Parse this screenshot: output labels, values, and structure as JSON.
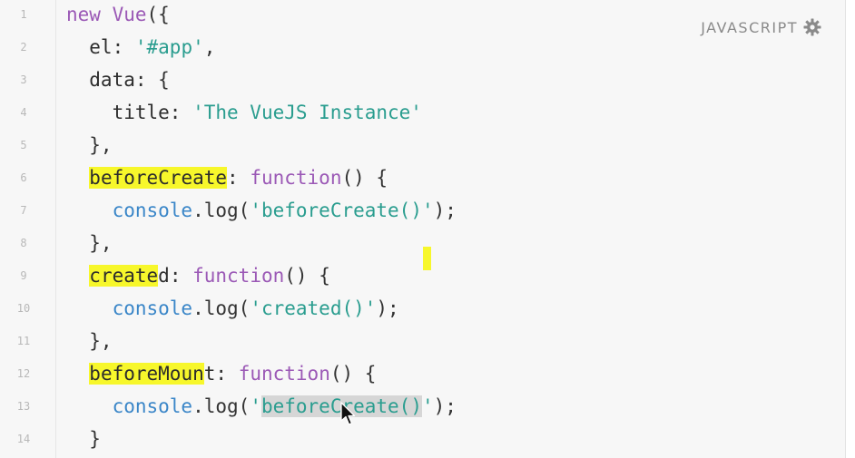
{
  "window": {
    "language_label": "JAVASCRIPT",
    "language_settings_icon": "gear-icon"
  },
  "editor": {
    "line_numbers": [
      "1",
      "2",
      "3",
      "4",
      "5",
      "6",
      "7",
      "8",
      "9",
      "10",
      "11",
      "12",
      "13",
      "14"
    ],
    "lines": [
      {
        "tokens": [
          {
            "text": "new ",
            "type": "kw"
          },
          {
            "text": "Vue",
            "type": "fn"
          },
          {
            "text": "({",
            "type": "pun"
          }
        ]
      },
      {
        "tokens": [
          {
            "text": "  el",
            "type": "id"
          },
          {
            "text": ": ",
            "type": "pun"
          },
          {
            "text": "'#app'",
            "type": "str"
          },
          {
            "text": ",",
            "type": "pun"
          }
        ]
      },
      {
        "tokens": [
          {
            "text": "  data",
            "type": "id"
          },
          {
            "text": ": {",
            "type": "pun"
          }
        ]
      },
      {
        "tokens": [
          {
            "text": "    title",
            "type": "id"
          },
          {
            "text": ": ",
            "type": "pun"
          },
          {
            "text": "'The VueJS Instance'",
            "type": "str"
          }
        ]
      },
      {
        "tokens": [
          {
            "text": "  },",
            "type": "pun"
          }
        ]
      },
      {
        "tokens": [
          {
            "text": "  ",
            "type": "pun"
          },
          {
            "text": "beforeCreate",
            "type": "id",
            "highlight": true
          },
          {
            "text": ": ",
            "type": "pun"
          },
          {
            "text": "function",
            "type": "kw"
          },
          {
            "text": "() {",
            "type": "pun"
          }
        ]
      },
      {
        "tokens": [
          {
            "text": "    ",
            "type": "pun"
          },
          {
            "text": "console",
            "type": "obj"
          },
          {
            "text": ".log(",
            "type": "pun"
          },
          {
            "text": "'beforeCreate()'",
            "type": "str"
          },
          {
            "text": ");",
            "type": "pun"
          }
        ]
      },
      {
        "tokens": [
          {
            "text": "  },",
            "type": "pun"
          }
        ]
      },
      {
        "tokens": [
          {
            "text": "  ",
            "type": "pun"
          },
          {
            "text": "create",
            "type": "id",
            "highlight": true
          },
          {
            "text": "d",
            "type": "id"
          },
          {
            "text": ": ",
            "type": "pun"
          },
          {
            "text": "function",
            "type": "kw"
          },
          {
            "text": "() {",
            "type": "pun"
          }
        ]
      },
      {
        "tokens": [
          {
            "text": "    ",
            "type": "pun"
          },
          {
            "text": "console",
            "type": "obj"
          },
          {
            "text": ".log(",
            "type": "pun"
          },
          {
            "text": "'created()'",
            "type": "str"
          },
          {
            "text": ");",
            "type": "pun"
          }
        ]
      },
      {
        "tokens": [
          {
            "text": "  },",
            "type": "pun"
          }
        ]
      },
      {
        "tokens": [
          {
            "text": "  ",
            "type": "pun"
          },
          {
            "text": "beforeMoun",
            "type": "id",
            "highlight": true
          },
          {
            "text": "t",
            "type": "id"
          },
          {
            "text": ": ",
            "type": "pun"
          },
          {
            "text": "function",
            "type": "kw"
          },
          {
            "text": "() {",
            "type": "pun"
          }
        ]
      },
      {
        "tokens": [
          {
            "text": "    ",
            "type": "pun"
          },
          {
            "text": "console",
            "type": "obj"
          },
          {
            "text": ".log(",
            "type": "pun"
          },
          {
            "text": "'",
            "type": "str"
          },
          {
            "text": "beforeCreate()",
            "type": "str",
            "selected": true
          },
          {
            "text": "'",
            "type": "str"
          },
          {
            "text": ");",
            "type": "pun"
          }
        ]
      },
      {
        "tokens": [
          {
            "text": "  }",
            "type": "pun"
          }
        ]
      }
    ]
  },
  "colors": {
    "highlight": "#f7f72b",
    "keyword": "#9b59b6",
    "string": "#2a9d8f",
    "object": "#3a86c8",
    "selection": "#d6d6d6"
  }
}
